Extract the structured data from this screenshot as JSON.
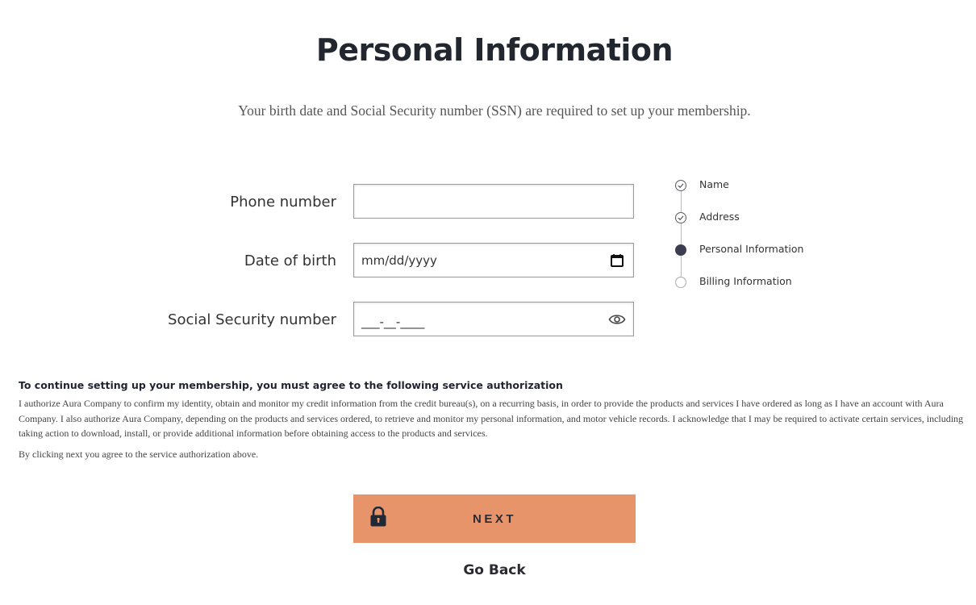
{
  "page": {
    "title": "Personal Information",
    "subtitle": "Your birth date and Social Security number (SSN) are required to set up your membership."
  },
  "form": {
    "phone": {
      "label": "Phone number",
      "value": "",
      "placeholder": ""
    },
    "dob": {
      "label": "Date of birth",
      "value": "mm/dd/yyyy",
      "icon": "calendar-icon"
    },
    "ssn": {
      "label": "Social Security number",
      "value": "___-__-____",
      "icon": "eye-icon"
    }
  },
  "stepper": {
    "steps": [
      {
        "label": "Name",
        "state": "completed"
      },
      {
        "label": "Address",
        "state": "completed"
      },
      {
        "label": "Personal Information",
        "state": "active"
      },
      {
        "label": "Billing Information",
        "state": "pending"
      }
    ]
  },
  "authorization": {
    "heading": "To continue setting up your membership, you must agree to the following service authorization",
    "body": "I authorize Aura Company to confirm my identity, obtain and monitor my credit information from the credit bureau(s), on a recurring basis, in order to provide the products and services I have ordered as long as I have an account with Aura Company. I also authorize Aura Company, depending on the products and services ordered, to retrieve and monitor my personal information, and motor vehicle records. I acknowledge that I may be required to activate certain services, including taking action to download, install, or provide additional information before obtaining access to the products and services.",
    "note": "By clicking next you agree to the service authorization above."
  },
  "actions": {
    "next_label": "NEXT",
    "next_icon": "lock-icon",
    "back_label": "Go Back"
  },
  "colors": {
    "accent": "#e8946a",
    "active_step": "#3d3d52"
  }
}
